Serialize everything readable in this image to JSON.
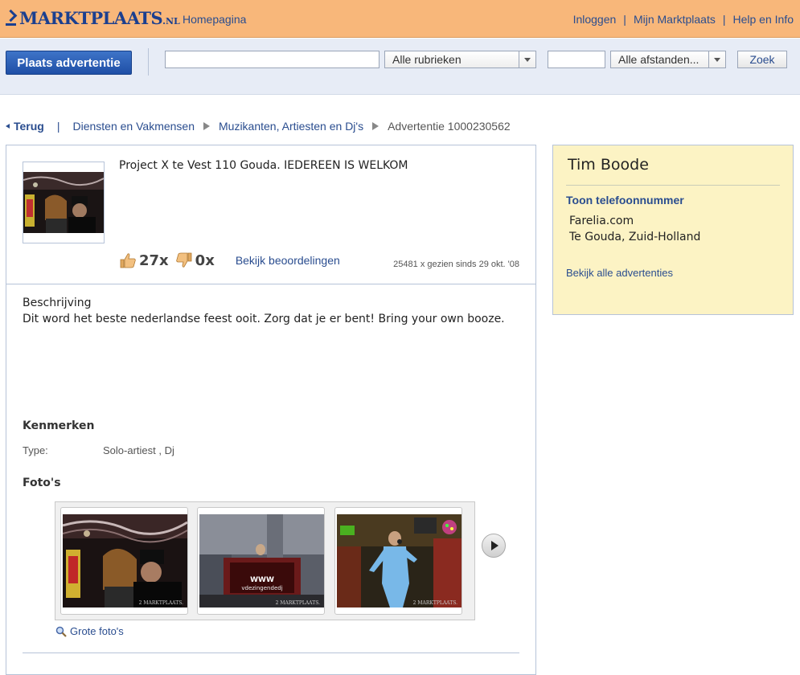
{
  "header": {
    "logo_text": "MARKTPLAATS",
    "logo_suffix": ".NL",
    "home_link": "Homepagina",
    "links": [
      "Inloggen",
      "Mijn Marktplaats",
      "Help en Info"
    ],
    "separator": "|"
  },
  "search": {
    "post_button": "Plaats advertentie",
    "query_value": "",
    "category_selected": "Alle rubrieken",
    "postcode_value": "",
    "distance_selected": "Alle afstanden...",
    "submit_label": "Zoek"
  },
  "breadcrumb": {
    "back": "Terug",
    "items": [
      "Diensten en Vakmensen",
      "Muzikanten, Artiesten en Dj's"
    ],
    "current": "Advertentie 1000230562"
  },
  "ad": {
    "title": "Project X te  Vest 110 Gouda. IEDEREEN IS WELKOM",
    "likes": "27x",
    "dislikes": "0x",
    "ratings_link": "Bekijk beoordelingen",
    "views": "25481 x gezien sinds 29 okt. '08",
    "description_heading": "Beschrijving",
    "description": "Dit word het beste nederlandse feest ooit. Zorg dat je er bent! Bring your own booze.",
    "features_heading": "Kenmerken",
    "type_label": "Type:",
    "type_value": "Solo-artiest , Dj",
    "photos_heading": "Foto's",
    "large_photos_link": "Grote foto's",
    "watermark": "2 MARKTPLAATS.",
    "photo2_banner": "WWW",
    "photo2_banner_sub": "vdezingendedj"
  },
  "seller": {
    "name": "Tim Boode",
    "phone_link": "Toon telefoonnummer",
    "website": "Farelia.com",
    "location": "Te Gouda, Zuid-Holland",
    "all_ads_link": "Bekijk alle advertenties"
  },
  "colors": {
    "header_bg": "#f8b77a",
    "search_bg": "#e7ecf6",
    "link": "#2a4d8f",
    "seller_bg": "#fcf3c4",
    "post_button": "#1f4fa6"
  }
}
